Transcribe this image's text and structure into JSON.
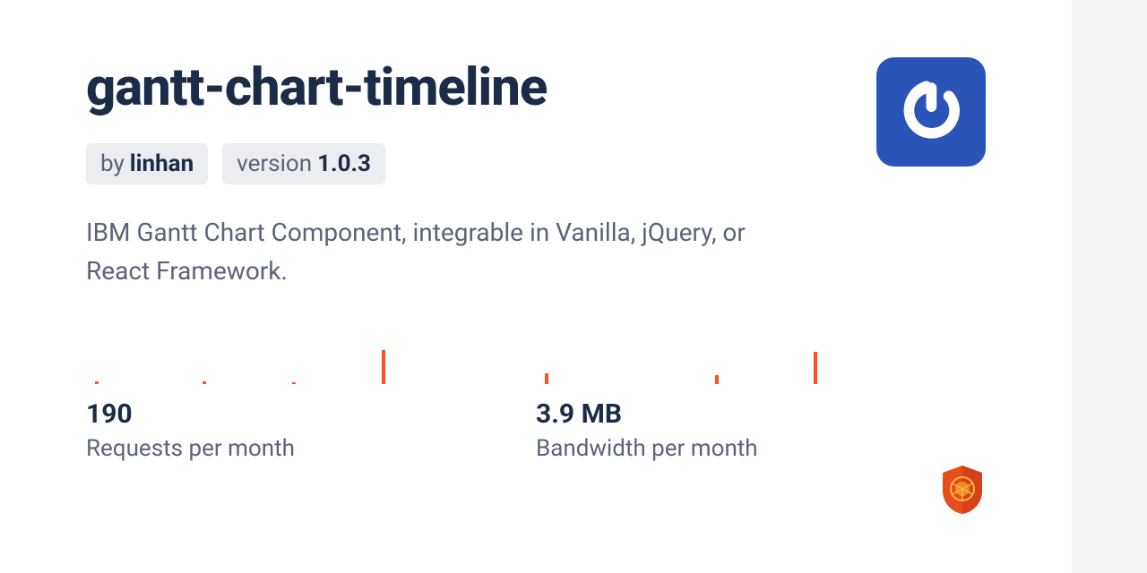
{
  "package": {
    "name": "gantt-chart-timeline",
    "author_prefix": "by",
    "author": "linhan",
    "version_prefix": "version",
    "version": "1.0.3",
    "description": "IBM Gantt Chart Component, integrable in Vanilla, jQuery, or React Framework."
  },
  "stats": {
    "requests": {
      "value": "190",
      "label": "Requests per month"
    },
    "bandwidth": {
      "value": "3.9 MB",
      "label": "Bandwidth per month"
    }
  },
  "colors": {
    "accent": "#ff4f26",
    "brand": "#2a54b8",
    "text_primary": "#1c2b46",
    "text_secondary": "#5a6478"
  }
}
